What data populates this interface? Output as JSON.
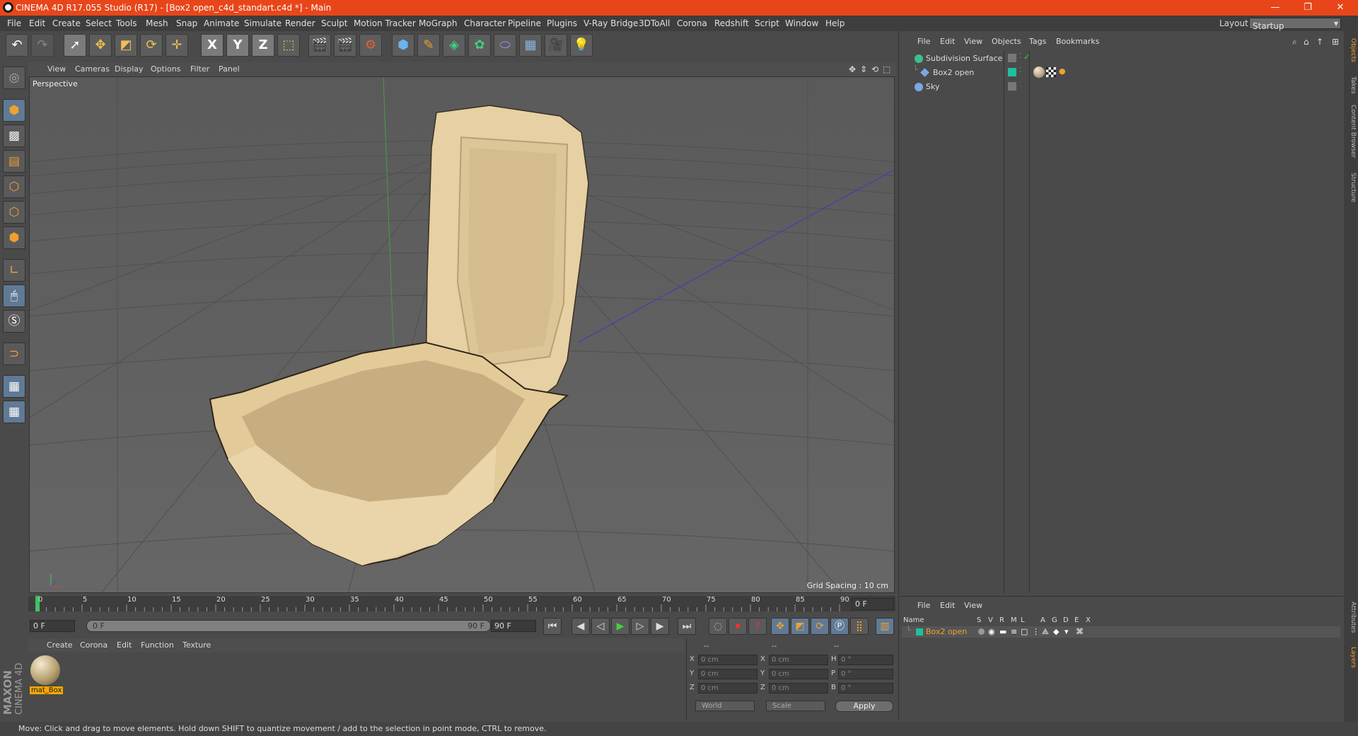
{
  "window": {
    "title": "CINEMA 4D R17.055 Studio (R17) - [Box2 open_c4d_standart.c4d *] - Main",
    "minimize": "—",
    "restore": "❐",
    "close": "✕"
  },
  "menubar": {
    "items": [
      "File",
      "Edit",
      "Create",
      "Select",
      "Tools",
      "Mesh",
      "Snap",
      "Animate",
      "Simulate",
      "Render",
      "Sculpt",
      "Motion Tracker",
      "MoGraph",
      "Character",
      "Pipeline",
      "Plugins",
      "V-Ray Bridge",
      "3DToAll",
      "Corona",
      "Redshift",
      "Script",
      "Window",
      "Help"
    ],
    "layout_label": "Layout:",
    "layout_value": "Startup"
  },
  "toolbar": {
    "icons": [
      "undo-icon",
      "redo-icon",
      "live-selection-icon",
      "move-icon",
      "scale-icon",
      "rotate-icon",
      "last-tool-icon",
      "x-axis-icon",
      "y-axis-icon",
      "z-axis-icon",
      "coordinate-system-icon",
      "render-view-icon",
      "render-picture-viewer-icon",
      "edit-render-settings-icon",
      "cube-icon",
      "pen-spline-icon",
      "subdivision-surface-icon",
      "cloner-icon",
      "deformer-icon",
      "floor-icon",
      "camera-icon",
      "light-icon"
    ],
    "axis_labels": [
      "X",
      "Y",
      "Z"
    ]
  },
  "viewport": {
    "menu": [
      "View",
      "Cameras",
      "Display",
      "Options",
      "Filter",
      "Panel"
    ],
    "label": "Perspective",
    "grid_spacing": "Grid Spacing : 10 cm"
  },
  "timeline": {
    "ticks": [
      "0",
      "5",
      "10",
      "15",
      "20",
      "25",
      "30",
      "35",
      "40",
      "45",
      "50",
      "55",
      "60",
      "65",
      "70",
      "75",
      "80",
      "85",
      "90"
    ],
    "current_frame": "0 F",
    "start_field": "0 F",
    "range_start": "0 F",
    "range_end": "90 F",
    "end_field": "90 F"
  },
  "material_manager": {
    "menu": [
      "Create",
      "Corona",
      "Edit",
      "Function",
      "Texture"
    ],
    "materials": [
      {
        "name": "mat_Box"
      }
    ]
  },
  "coordinates": {
    "headers": [
      "--",
      "--",
      "--"
    ],
    "rows": [
      {
        "a": "X",
        "av": "0 cm",
        "b": "X",
        "bv": "0 cm",
        "c": "H",
        "cv": "0 °"
      },
      {
        "a": "Y",
        "av": "0 cm",
        "b": "Y",
        "bv": "0 cm",
        "c": "P",
        "cv": "0 °"
      },
      {
        "a": "Z",
        "av": "0 cm",
        "b": "Z",
        "bv": "0 cm",
        "c": "B",
        "cv": "0 °"
      }
    ],
    "mode1": "World",
    "mode2": "Scale",
    "apply": "Apply"
  },
  "object_manager": {
    "menu": [
      "File",
      "Edit",
      "View",
      "Objects",
      "Tags",
      "Bookmarks"
    ],
    "objects": [
      {
        "name": "Subdivision Surface",
        "icon": "subdivision-icon",
        "color": "#3ec08a"
      },
      {
        "name": "Box2 open",
        "icon": "polygon-object-icon",
        "color": "#7aa8e0"
      },
      {
        "name": "Sky",
        "icon": "sky-icon",
        "color": "#7aa8e0"
      }
    ]
  },
  "right_tabs": [
    "Objects",
    "Takes",
    "Content Browser",
    "Structure",
    "Attributes",
    "Layers"
  ],
  "layer_manager": {
    "menu": [
      "File",
      "Edit",
      "View"
    ],
    "columns": [
      "Name",
      "S",
      "V",
      "R",
      "M",
      "L",
      "A",
      "G",
      "D",
      "E",
      "X"
    ],
    "layers": [
      {
        "name": "Box2 open",
        "color": "#1ec0a0"
      }
    ]
  },
  "maxon": {
    "brand": "MAXON",
    "product": "CINEMA 4D"
  },
  "status": {
    "text": "Move: Click and drag to move elements. Hold down SHIFT to quantize movement / add to the selection in point mode, CTRL to remove."
  }
}
